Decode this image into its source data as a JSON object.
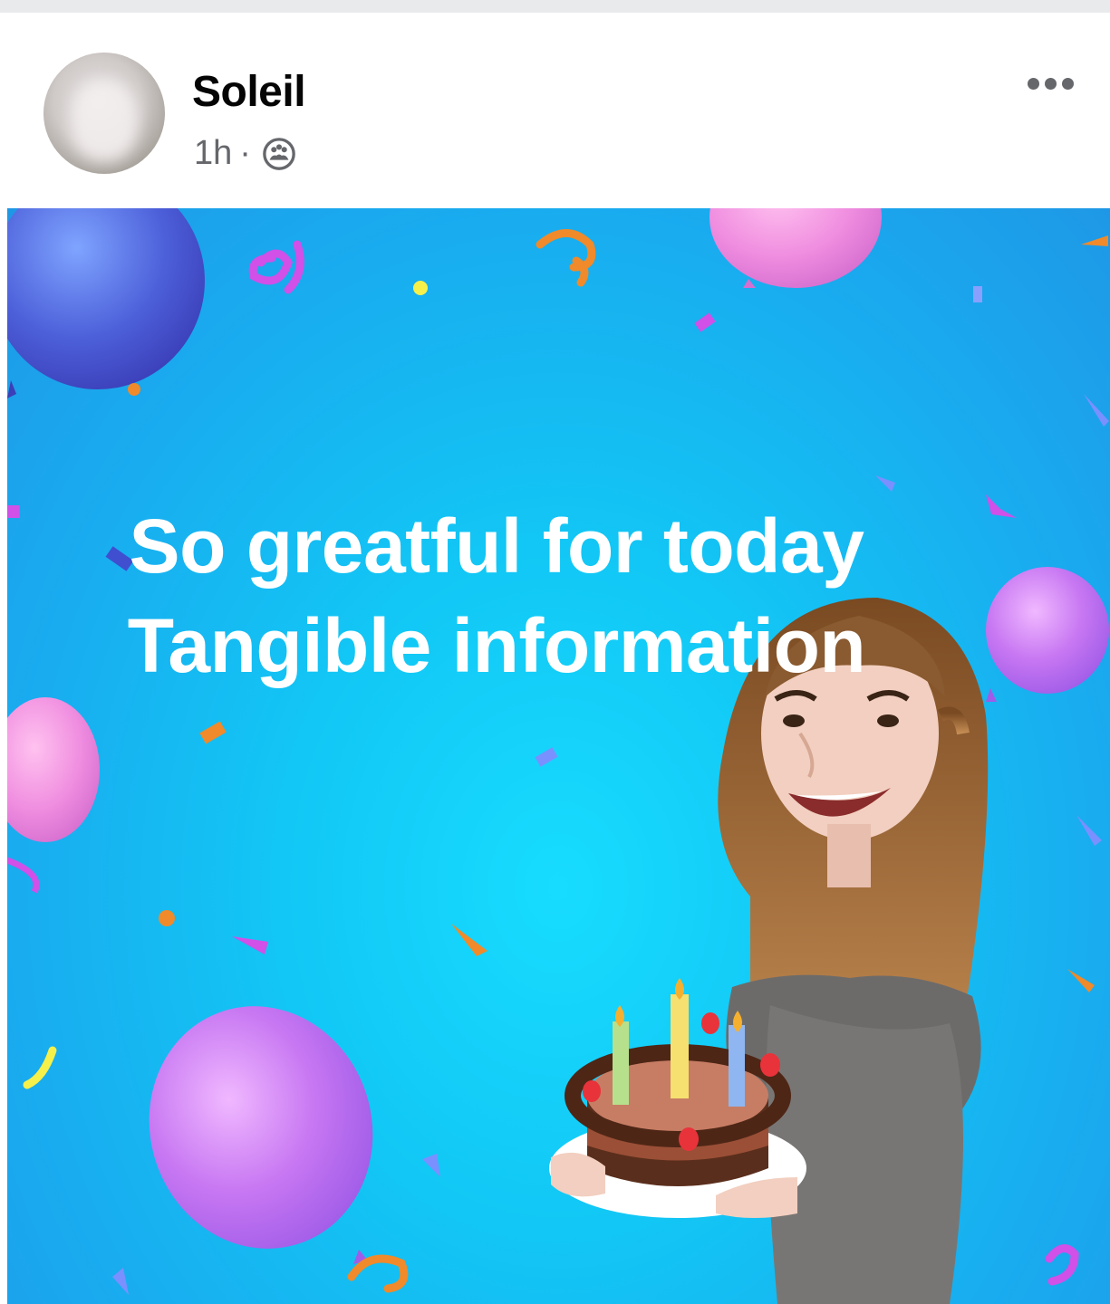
{
  "post": {
    "author": "Soleil",
    "time": "1h",
    "separator": "·",
    "audience_icon": "friends-icon",
    "more_icon": "more-options-icon"
  },
  "image": {
    "line1": "So greatful for today",
    "line2": "Tangible information"
  },
  "colors": {
    "background": "#12c7f5",
    "text": "#ffffff",
    "meta": "#65676b"
  }
}
